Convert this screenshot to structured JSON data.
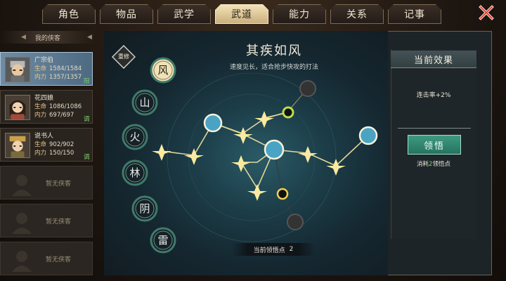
{
  "tabs": [
    "角色",
    "物品",
    "武学",
    "武道",
    "能力",
    "关系",
    "记事"
  ],
  "active_tab_index": 3,
  "roster": {
    "header": "我的侠客",
    "members": [
      {
        "name": "广宗伯",
        "hp_label": "生命",
        "hp": "1584/1584",
        "mp_label": "内力",
        "mp": "1357/1357",
        "tag": "阳",
        "selected": true
      },
      {
        "name": "花四娘",
        "hp_label": "生命",
        "hp": "1086/1086",
        "mp_label": "内力",
        "mp": "697/697",
        "tag": "调",
        "selected": false
      },
      {
        "name": "说书人",
        "hp_label": "生命",
        "hp": "902/902",
        "mp_label": "内力",
        "mp": "150/150",
        "tag": "调",
        "selected": false
      }
    ],
    "empty_label": "暂无侠客",
    "empty_count": 3
  },
  "dao": {
    "learn_badge": "重修",
    "title": "其疾如风",
    "subtitle": "速度见长，适合抢步快攻的打法",
    "styles": [
      "风",
      "山",
      "火",
      "林",
      "阴",
      "雷"
    ],
    "active_style_index": 0,
    "points_label": "当前领悟点",
    "points_value": "2"
  },
  "effect": {
    "header": "当前效果",
    "text": "连击率+2%",
    "button": "领悟",
    "cost_prefix": "消耗",
    "cost_value": "2",
    "cost_suffix": "领悟点"
  },
  "colors": {
    "accent_green": "#2e8a73",
    "active_tab": "#e6d3a5",
    "gold_node": "#f6e28a",
    "close_red": "#d83a2e"
  }
}
